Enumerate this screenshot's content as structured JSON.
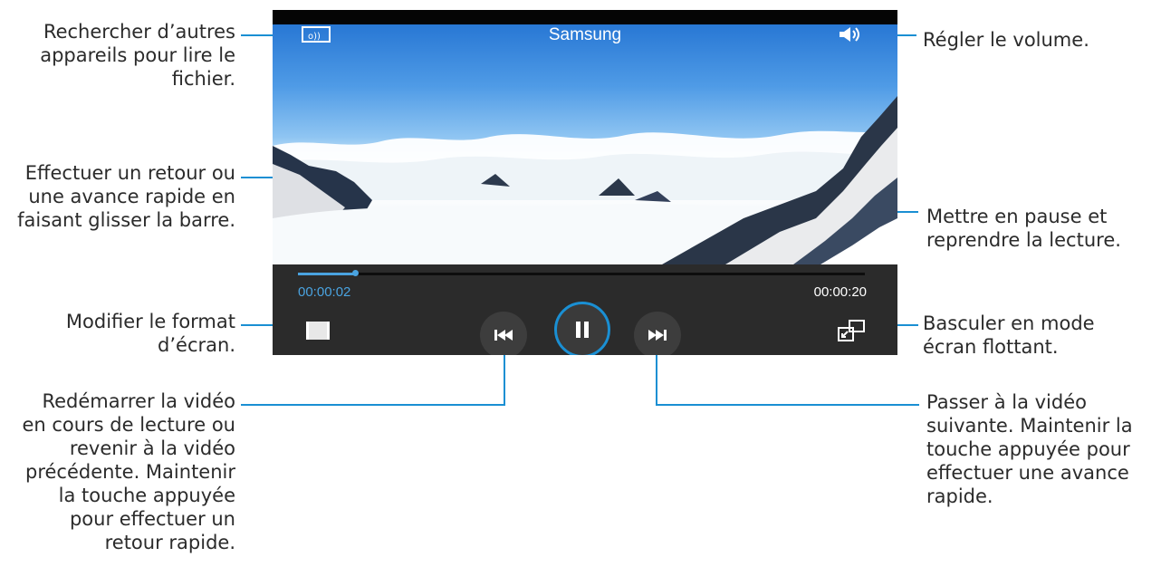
{
  "player": {
    "title": "Samsung",
    "current_time": "00:00:02",
    "total_time": "00:00:20",
    "progress": 0.1,
    "accent_color": "#4aa3e0",
    "icons": {
      "cast": "screen-mirroring-icon",
      "volume": "volume-icon",
      "aspect": "aspect-ratio-icon",
      "prev": "rewind-icon",
      "pause": "pause-icon",
      "next": "fast-forward-icon",
      "popup": "popup-window-icon"
    }
  },
  "callouts": {
    "search_devices": "Rechercher d’autres\nappareils pour lire le\nfichier.",
    "scrub": "Effectuer un retour ou\nune avance rapide en\nfaisant glisser la barre.",
    "aspect": "Modifier le format\nd’écran.",
    "restart": "Redémarrer la vidéo\nen cours de lecture ou\nrevenir à la vidéo\nprécédente. Maintenir\nla touche appuyée\npour effectuer un\nretour rapide.",
    "volume": "Régler le volume.",
    "pause": "Mettre en pause et\nreprendre la lecture.",
    "popup": "Basculer en mode\nécran flottant.",
    "next": "Passer à la vidéo\nsuivante. Maintenir la\ntouche appuyée pour\neffectuer une avance\nrapide."
  },
  "colors": {
    "callout_line": "#1a8fd3",
    "controls_bg": "#2b2b2b",
    "time_current": "#4aa3e0",
    "time_total": "#ffffff"
  }
}
